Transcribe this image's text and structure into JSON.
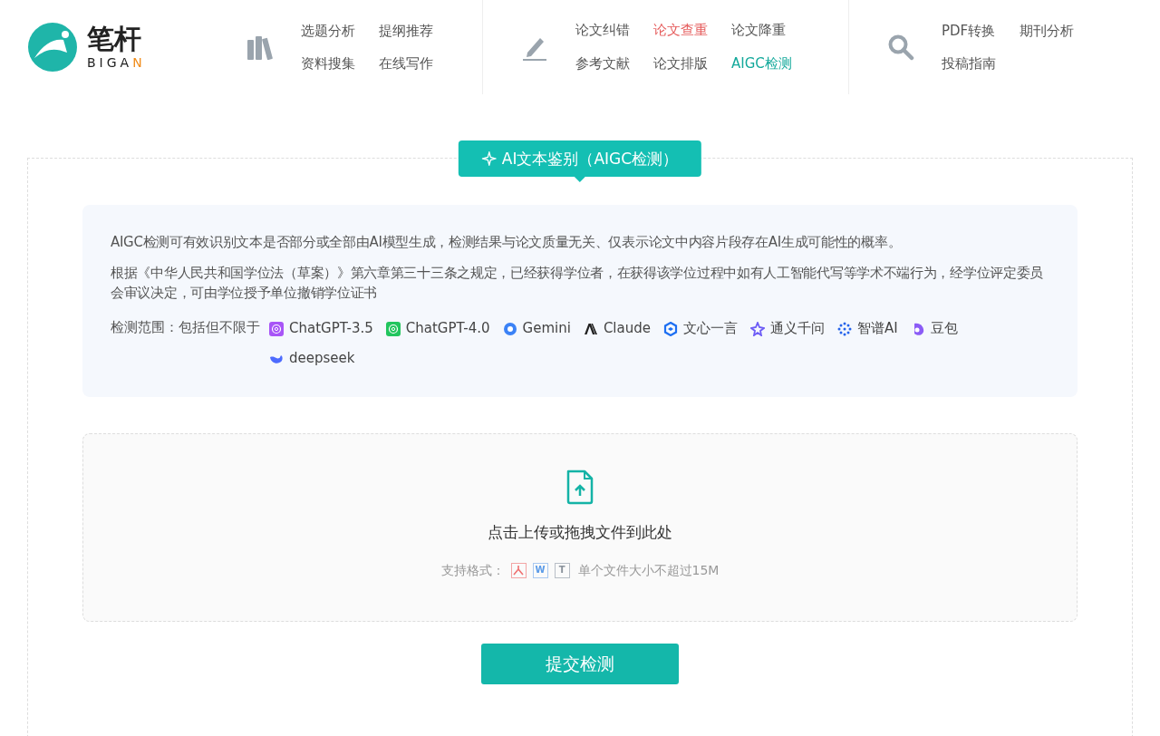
{
  "logo": {
    "name": "笔杆",
    "latin_start": "BIGA",
    "latin_end": "N"
  },
  "nav_groups": [
    {
      "kind": "books",
      "links": [
        {
          "label": "选题分析",
          "selected": false,
          "color": "#555555"
        },
        {
          "label": "提纲推荐",
          "selected": false,
          "color": "#555555"
        },
        {
          "label": "资料搜集",
          "selected": false,
          "color": "#555555"
        },
        {
          "label": "在线写作",
          "selected": false,
          "color": "#555555"
        }
      ]
    },
    {
      "kind": "pencil",
      "links": [
        {
          "label": "论文纠错",
          "selected": false,
          "color": "#555555"
        },
        {
          "label": "论文查重",
          "selected": false,
          "color": "#e55a5a"
        },
        {
          "label": "论文降重",
          "selected": false,
          "color": "#555555"
        },
        {
          "label": "参考文献",
          "selected": false,
          "color": "#555555"
        },
        {
          "label": "论文排版",
          "selected": false,
          "color": "#555555"
        },
        {
          "label": "AIGC检测",
          "selected": true,
          "color": "#14a99b"
        }
      ]
    },
    {
      "kind": "search",
      "links": [
        {
          "label": "PDF转换",
          "selected": false,
          "color": "#555555"
        },
        {
          "label": "期刊分析",
          "selected": false,
          "color": "#555555"
        },
        {
          "label": "投稿指南",
          "selected": false,
          "color": "#555555"
        }
      ]
    }
  ],
  "badge": "AI文本鉴别（AIGC检测）",
  "info": {
    "paragraphs": [
      "AIGC检测可有效识别文本是否部分或全部由AI模型生成，检测结果与论文质量无关、仅表示论文中内容片段存在AI生成可能性的概率。",
      "根据《中华人民共和国学位法（草案）》第六章第三十三条之规定，已经获得学位者，在获得该学位过程中如有人工智能代写等学术不端行为，经学位评定委员会审议决定，可由学位授予单位撤销学位证书"
    ],
    "scope_label": "检测范围：包括但不限于",
    "models": [
      {
        "name": "ChatGPT-3.5",
        "kind": "openai",
        "color": "#a855f7"
      },
      {
        "name": "ChatGPT-4.0",
        "kind": "openai",
        "color": "#22c55e"
      },
      {
        "name": "Gemini",
        "kind": "swirl",
        "color": "#3b82f6"
      },
      {
        "name": "Claude",
        "kind": "claude",
        "color": "#222222"
      },
      {
        "name": "文心一言",
        "kind": "cube",
        "color": "#1d6ff2"
      },
      {
        "name": "通义千问",
        "kind": "star",
        "color": "#6d5cf6"
      },
      {
        "name": "智谱AI",
        "kind": "dots",
        "color": "#2563eb"
      },
      {
        "name": "豆包",
        "kind": "bean",
        "color": "#8b5cf6"
      },
      {
        "name": "deepseek",
        "kind": "whale",
        "color": "#4d6bfe"
      }
    ]
  },
  "upload": {
    "prompt": "点击上传或拖拽文件到此处",
    "formats_label": "支持格式：",
    "formats": [
      {
        "kind": "pdf"
      },
      {
        "kind": "word",
        "letter": "W"
      },
      {
        "kind": "text",
        "letter": "T"
      }
    ],
    "limit": "单个文件大小不超过15M"
  },
  "submit": "提交检测"
}
